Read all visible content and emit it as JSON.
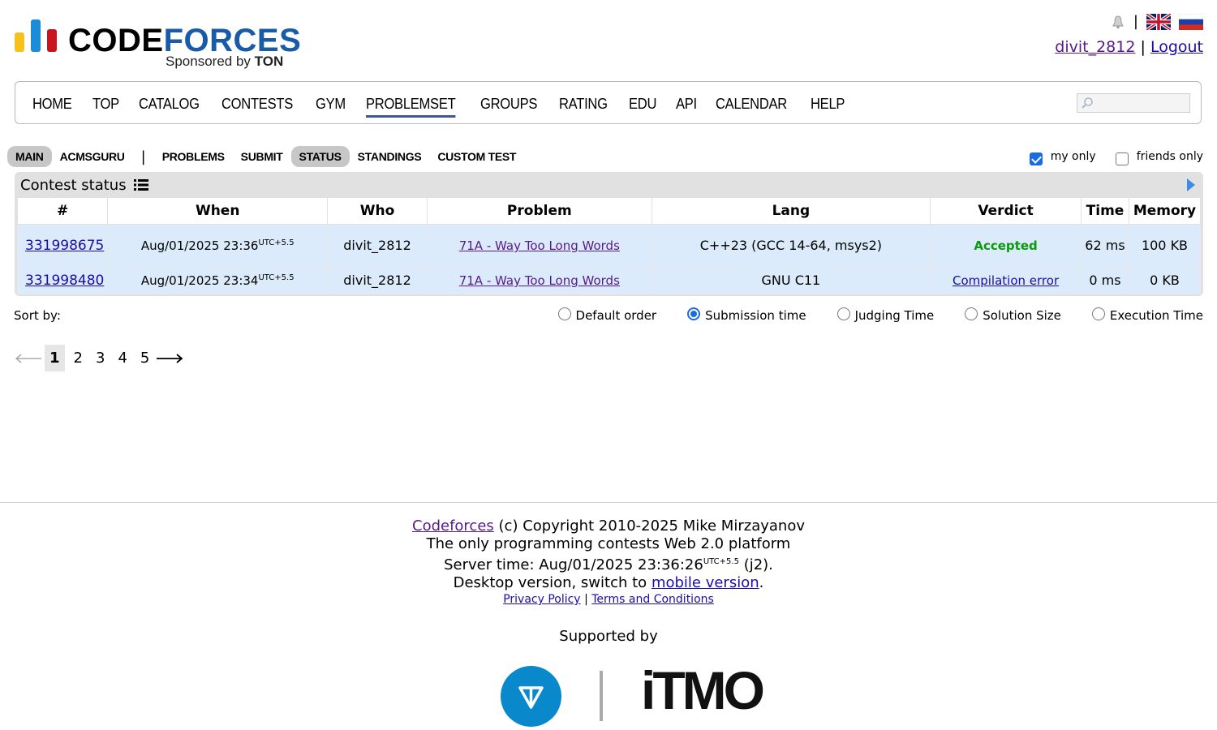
{
  "header": {
    "brand_code": "CODE",
    "brand_forces": "FORCES",
    "sponsor_prefix": "Sponsored by",
    "sponsor_name": "TON",
    "separator": "|",
    "username": "divit_2812",
    "logout": "Logout",
    "colors": {
      "bar_yellow": "#f6c21b",
      "bar_blue": "#1a8cd8",
      "bar_red": "#c4161c",
      "brand_blue": "#1a5ba8"
    }
  },
  "menu": {
    "items": [
      "HOME",
      "TOP",
      "CATALOG",
      "CONTESTS",
      "GYM",
      "PROBLEMSET",
      "GROUPS",
      "RATING",
      "EDU",
      "API",
      "CALENDAR",
      "HELP"
    ],
    "active": "PROBLEMSET"
  },
  "subnav": {
    "main": "MAIN",
    "acmsguru": "ACMSGURU",
    "pipe": "|",
    "problems": "PROBLEMS",
    "submit": "SUBMIT",
    "status": "STATUS",
    "standings": "STANDINGS",
    "custom_test": "CUSTOM TEST",
    "my_only": "my only",
    "friends_only": "friends only"
  },
  "status": {
    "title": "Contest status",
    "columns": [
      "#",
      "When",
      "Who",
      "Problem",
      "Lang",
      "Verdict",
      "Time",
      "Memory"
    ],
    "rows": [
      {
        "id": "331998675",
        "when": "Aug/01/2025 23:36",
        "tz": "UTC+5.5",
        "who": "divit_2812",
        "problem": "71A - Way Too Long Words",
        "lang": "C++23 (GCC 14-64, msys2)",
        "verdict": "Accepted",
        "time": "62 ms",
        "memory": "100 KB"
      },
      {
        "id": "331998480",
        "when": "Aug/01/2025 23:34",
        "tz": "UTC+5.5",
        "who": "divit_2812",
        "problem": "71A - Way Too Long Words",
        "lang": "GNU C11",
        "verdict": "Compilation error",
        "time": "0 ms",
        "memory": "0 KB"
      }
    ]
  },
  "sort": {
    "label": "Sort by:",
    "options": [
      "Default order",
      "Submission time",
      "Judging Time",
      "Solution Size",
      "Execution Time"
    ],
    "selected": "Submission time"
  },
  "pager": {
    "pages": [
      "1",
      "2",
      "3",
      "4",
      "5"
    ],
    "current": "1"
  },
  "footer": {
    "codeforces": "Codeforces",
    "copyright": "(c) Copyright 2010-2025 Mike Mirzayanov",
    "tagline": "The only programming contests Web 2.0 platform",
    "server_time_label": "Server time: Aug/01/2025 23:36:26",
    "server_tz": "UTC+5.5",
    "server_suffix": "(j2).",
    "desktop_prefix": "Desktop version, switch to",
    "mobile_version": "mobile version",
    "desktop_suffix": ".",
    "privacy": "Privacy Policy",
    "bar": "|",
    "terms": "Terms and Conditions",
    "supported_by": "Supported by",
    "itmo": "iTMO"
  }
}
